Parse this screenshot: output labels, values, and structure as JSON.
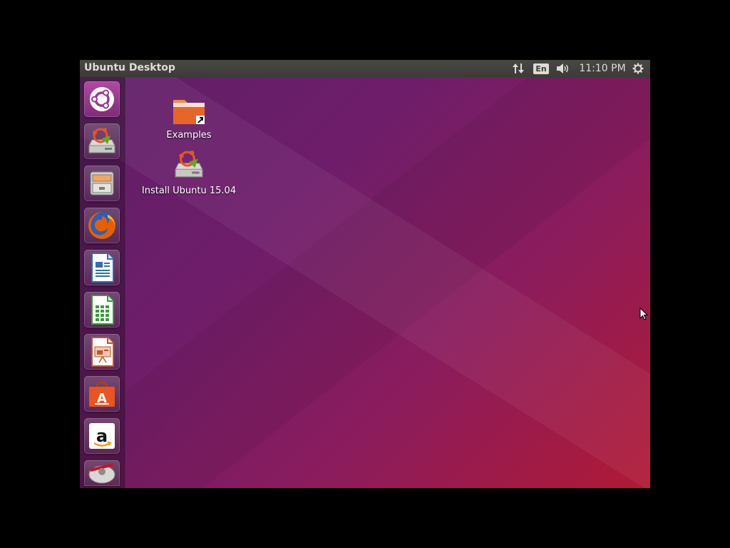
{
  "panel": {
    "title": "Ubuntu Desktop",
    "language": "En",
    "clock": "11:10 PM",
    "network_icon": "network-updown-icon",
    "sound_icon": "speaker-icon",
    "session_icon": "gear-icon"
  },
  "launcher": {
    "items": [
      {
        "name": "dash",
        "icon": "ubuntu-logo-icon"
      },
      {
        "name": "install-ubuntu",
        "icon": "installer-icon"
      },
      {
        "name": "files",
        "icon": "file-cabinet-icon"
      },
      {
        "name": "firefox",
        "icon": "firefox-icon"
      },
      {
        "name": "libreoffice-writer",
        "icon": "writer-icon"
      },
      {
        "name": "libreoffice-calc",
        "icon": "calc-icon"
      },
      {
        "name": "libreoffice-impress",
        "icon": "impress-icon"
      },
      {
        "name": "software-center",
        "icon": "shopping-bag-icon"
      },
      {
        "name": "amazon",
        "icon": "amazon-icon"
      },
      {
        "name": "system-settings",
        "icon": "settings-icon"
      }
    ]
  },
  "desktop": {
    "icons": [
      {
        "label": "Examples",
        "icon": "folder-link-icon"
      },
      {
        "label": "Install Ubuntu 15.04",
        "icon": "installer-icon"
      }
    ]
  },
  "colors": {
    "panel": "#3c3b37",
    "panel_text": "#dfdbd2",
    "wallpaper_start": "#5e1f66",
    "wallpaper_end": "#b01a35",
    "ubuntu_orange": "#e95420"
  }
}
